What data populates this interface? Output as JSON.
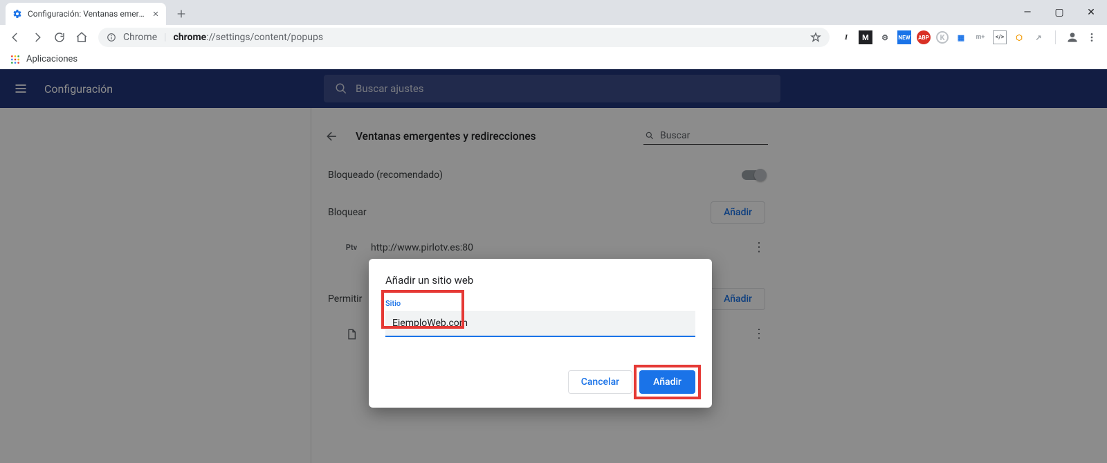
{
  "browser": {
    "tab_title": "Configuración: Ventanas emergentes",
    "url_scheme": "chrome",
    "url_path": "://settings/content/popups",
    "chrome_label": "Chrome",
    "bookmark_apps": "Aplicaciones",
    "window_controls": {
      "min": "—",
      "max": "▢",
      "close": "✕"
    },
    "extensions": [
      "I",
      "M",
      "⚙",
      "NEW",
      "ABP",
      "K",
      "▦",
      "m+",
      "</>",
      "⬡",
      "↗"
    ]
  },
  "settings": {
    "header_title": "Configuración",
    "search_placeholder": "Buscar ajustes",
    "page_title": "Ventanas emergentes y redirecciones",
    "page_search_placeholder": "Buscar",
    "blocked_label": "Bloqueado (recomendado)",
    "block_section": "Bloquear",
    "allow_section": "Permitir",
    "add_button": "Añadir",
    "blocked_sites": [
      {
        "favicon": "Ptv",
        "url": "http://www.pirlotv.es:80"
      }
    ],
    "allowed_sites": [
      {
        "favicon": "",
        "url": ""
      }
    ]
  },
  "dialog": {
    "title": "Añadir un sitio web",
    "field_label": "Sitio",
    "input_value": "EjemploWeb.com",
    "cancel": "Cancelar",
    "confirm": "Añadir"
  }
}
